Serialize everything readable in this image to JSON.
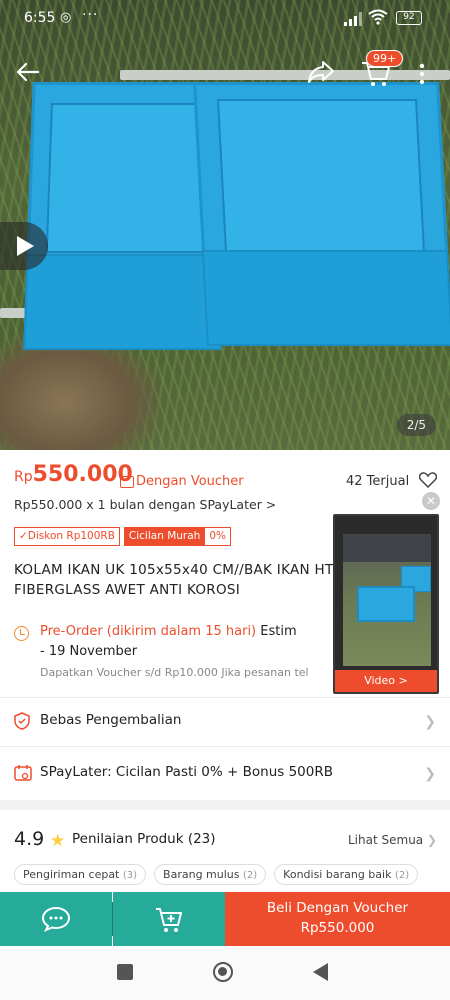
{
  "status_bar": {
    "time": "6:55",
    "battery": "92"
  },
  "gallery": {
    "counter": "2/5",
    "cart_badge": "99+"
  },
  "price": {
    "currency": "Rp",
    "amount": "550.000",
    "voucher_label": "Dengan Voucher",
    "sold": "42 Terjual",
    "spaylater": "Rp550.000 x 1 bulan dengan SPayLater >"
  },
  "tags": {
    "discount": "✓Diskon Rp100RB",
    "installment": "Cicilan Murah",
    "installment_pct": "0%"
  },
  "product": {
    "title_line1": "KOLAM IKAN UK 105x55x40 CM//BAK IKAN HTM",
    "title_line2": "FIBERGLASS AWET ANTI KOROSI"
  },
  "preorder": {
    "label": "Pre-Order (dikirim dalam 15 hari)",
    "estimate": "Estim",
    "line2": "- 19 November",
    "voucher_note": "Dapatkan Voucher s/d Rp10.000 Jika pesanan tel"
  },
  "rows": {
    "returns": "Bebas Pengembalian",
    "spaylater": "SPayLater: Cicilan Pasti 0% + Bonus 500RB"
  },
  "rating": {
    "score": "4.9",
    "label": "Penilaian Produk (23)",
    "see_all": "Lihat Semua",
    "chips": [
      {
        "label": "Pengiriman cepat",
        "count": "(3)"
      },
      {
        "label": "Barang mulus",
        "count": "(2)"
      },
      {
        "label": "Kondisi barang baik",
        "count": "(2)"
      }
    ]
  },
  "pip": {
    "video_label": "Video >"
  },
  "bottom_bar": {
    "buy_line1": "Beli Dengan Voucher",
    "buy_line2": "Rp550.000"
  },
  "colors": {
    "brand": "#ee4d2d",
    "teal": "#26aa99",
    "star": "#ffce3d"
  }
}
